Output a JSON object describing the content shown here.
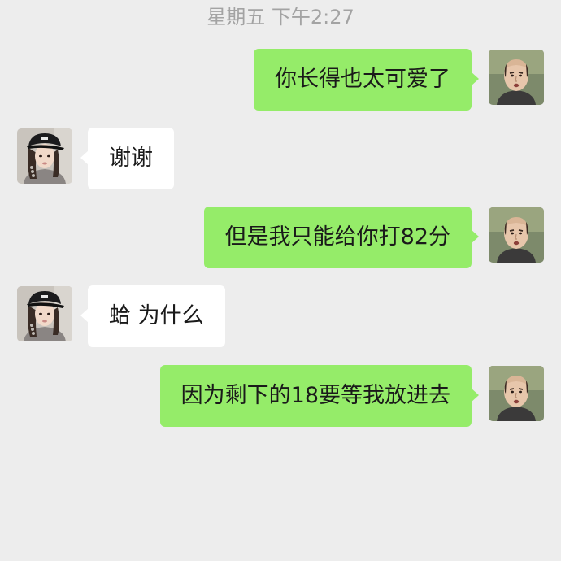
{
  "timestamp": "星期五 下午2:27",
  "messages": [
    {
      "sender": "me",
      "text": "你长得也太可爱了",
      "avatar": "bald-man-avatar"
    },
    {
      "sender": "other",
      "text": "谢谢",
      "avatar": "girl-in-cap-avatar"
    },
    {
      "sender": "me",
      "text": "但是我只能给你打82分",
      "avatar": "bald-man-avatar"
    },
    {
      "sender": "other",
      "text": "蛤 为什么",
      "avatar": "girl-in-cap-avatar"
    },
    {
      "sender": "me",
      "text": "因为剩下的18要等我放进去",
      "avatar": "bald-man-avatar"
    }
  ],
  "colors": {
    "background": "#ededed",
    "sent_bubble": "#95ec69",
    "received_bubble": "#ffffff",
    "timestamp_text": "#a3a3a3"
  }
}
